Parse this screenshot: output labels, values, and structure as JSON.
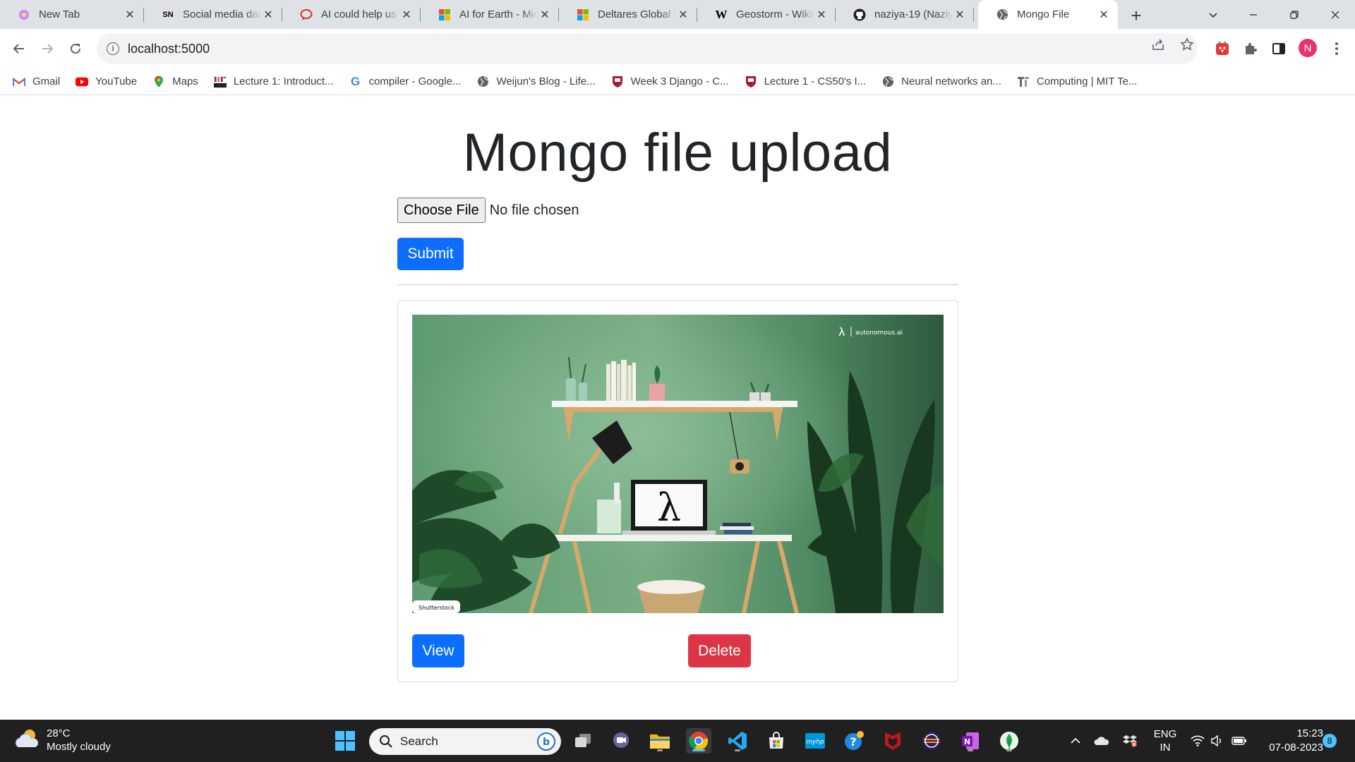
{
  "browser": {
    "tabs": [
      {
        "title": "New Tab",
        "icon": "new-tab-icon",
        "active": false
      },
      {
        "title": "Social media data",
        "icon": "sn-icon",
        "favicon_text": "SN",
        "active": false
      },
      {
        "title": "AI could help us r",
        "icon": "chat-icon",
        "active": false
      },
      {
        "title": "AI for Earth - Micr",
        "icon": "microsoft-icon",
        "active": false
      },
      {
        "title": "Deltares Global Fl",
        "icon": "microsoft-icon",
        "active": false
      },
      {
        "title": "Geostorm - Wikip",
        "icon": "wikipedia-icon",
        "favicon_text": "W",
        "active": false
      },
      {
        "title": "naziya-19 (Naziya",
        "icon": "github-icon",
        "active": false
      },
      {
        "title": "Mongo File",
        "icon": "globe-icon",
        "active": true
      }
    ],
    "url": "localhost:5000",
    "profile_initial": "N",
    "bookmarks": [
      {
        "label": "Gmail",
        "icon": "gmail-icon"
      },
      {
        "label": "YouTube",
        "icon": "youtube-icon"
      },
      {
        "label": "Maps",
        "icon": "maps-icon"
      },
      {
        "label": "Lecture 1: Introduct...",
        "icon": "mit-icon"
      },
      {
        "label": "compiler - Google...",
        "icon": "google-icon",
        "favicon_text": "G"
      },
      {
        "label": "Weijun's Blog - Life...",
        "icon": "globe-icon"
      },
      {
        "label": "Week 3 Django - C...",
        "icon": "harvard-icon"
      },
      {
        "label": "Lecture 1 - CS50's I...",
        "icon": "harvard-icon"
      },
      {
        "label": "Neural networks an...",
        "icon": "globe-icon"
      },
      {
        "label": "Computing | MIT Te...",
        "icon": "mit-tr-icon"
      }
    ]
  },
  "page": {
    "title": "Mongo file upload",
    "choose_file_label": "Choose File",
    "file_status": "No file chosen",
    "submit_label": "Submit",
    "card": {
      "image_watermark": "autonomous.ai",
      "image_credit": "Shutterstock",
      "view_label": "View",
      "delete_label": "Delete"
    }
  },
  "taskbar": {
    "temperature": "28°C",
    "weather": "Mostly cloudy",
    "search_label": "Search",
    "language": "ENG",
    "region": "IN",
    "time": "15:23",
    "date": "07-08-2023",
    "notifications": "8"
  },
  "colors": {
    "primary": "#0d6efd",
    "danger": "#dc3545",
    "tabstrip": "#dee1e6",
    "taskbar": "#202020"
  }
}
